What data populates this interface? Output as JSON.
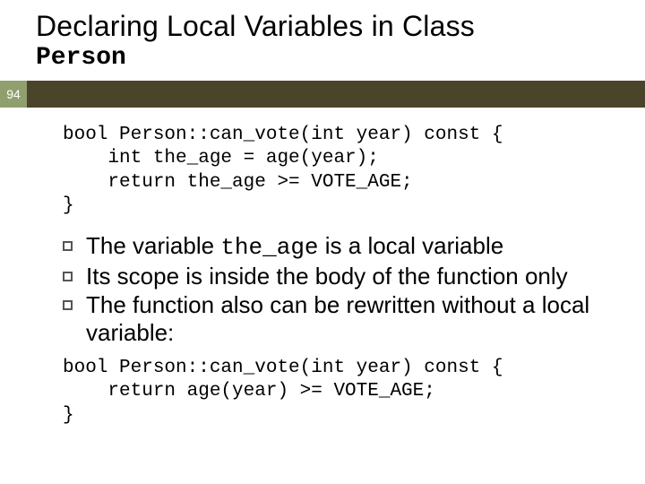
{
  "title": {
    "line1": "Declaring Local Variables in Class",
    "line2": "Person"
  },
  "slide_number": "94",
  "code1": {
    "l1": "bool Person::can_vote(int year) const {",
    "l2": "    int the_age = age(year);",
    "l3": "    return the_age >= VOTE_AGE;",
    "l4": "}"
  },
  "bullets": {
    "b1_pre": "The variable ",
    "b1_code": "the_age",
    "b1_post": " is a local variable",
    "b2": "Its scope is inside the body of the function only",
    "b3": "The function also can be rewritten without a local variable:"
  },
  "code2": {
    "l1": "bool Person::can_vote(int year) const {",
    "l2": "    return age(year) >= VOTE_AGE;",
    "l3": "}"
  }
}
